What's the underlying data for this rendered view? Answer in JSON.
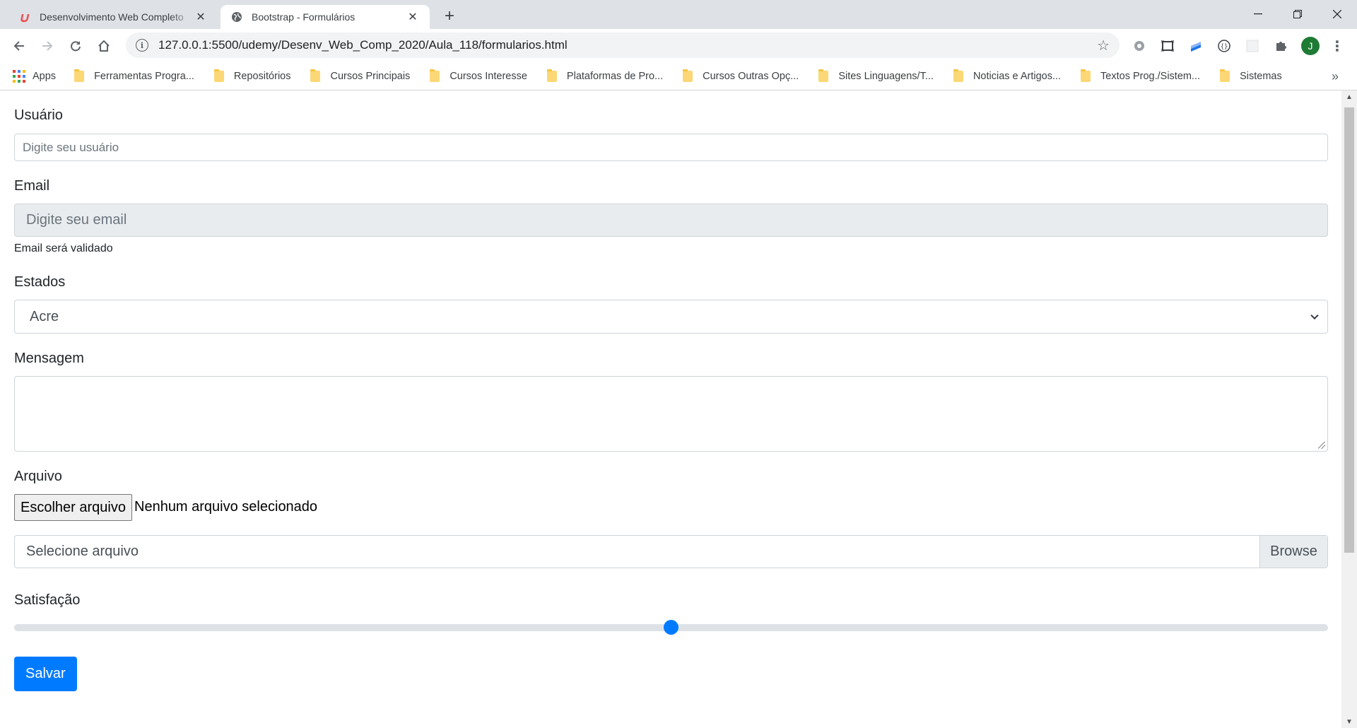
{
  "browser": {
    "tabs": [
      {
        "title": "Desenvolvimento Web Completo",
        "favicon": "udemy-icon",
        "active": false
      },
      {
        "title": "Bootstrap - Formulários",
        "favicon": "globe-icon",
        "active": true
      }
    ],
    "new_tab_label": "+",
    "window_controls": {
      "minimize": "—",
      "restore": "❐",
      "close": "✕"
    },
    "url": "127.0.0.1:5500/udemy/Desenv_Web_Comp_2020/Aula_118/formularios.html",
    "bookmarks": [
      {
        "label": "Apps",
        "icon": "apps-grid-icon"
      },
      {
        "label": "Ferramentas Progra...",
        "icon": "folder-icon"
      },
      {
        "label": "Repositórios",
        "icon": "folder-icon"
      },
      {
        "label": "Cursos Principais",
        "icon": "folder-icon"
      },
      {
        "label": "Cursos Interesse",
        "icon": "folder-icon"
      },
      {
        "label": "Plataformas de Pro...",
        "icon": "folder-icon"
      },
      {
        "label": "Cursos Outras Opç...",
        "icon": "folder-icon"
      },
      {
        "label": "Sites Linguagens/T...",
        "icon": "folder-icon"
      },
      {
        "label": "Noticias e Artigos...",
        "icon": "folder-icon"
      },
      {
        "label": "Textos Prog./Sistem...",
        "icon": "folder-icon"
      },
      {
        "label": "Sistemas",
        "icon": "folder-icon"
      }
    ],
    "bookmarks_more": "»",
    "profile_initial": "J",
    "colors": {
      "tabbar": "#dee1e6",
      "omnibox": "#f1f3f4",
      "profile": "#1e7b34",
      "folder": "#fbd775"
    }
  },
  "form": {
    "usuario": {
      "label": "Usuário",
      "placeholder": "Digite seu usuário",
      "value": ""
    },
    "email": {
      "label": "Email",
      "placeholder": "Digite seu email",
      "help": "Email será validado"
    },
    "estados": {
      "label": "Estados",
      "selected": "Acre"
    },
    "mensagem": {
      "label": "Mensagem",
      "value": ""
    },
    "arquivo": {
      "label": "Arquivo",
      "button": "Escolher arquivo",
      "status": "Nenhum arquivo selecionado",
      "custom_placeholder": "Selecione arquivo",
      "browse": "Browse"
    },
    "satisfacao": {
      "label": "Satisfação",
      "value_fraction": 0.5
    },
    "submit": "Salvar",
    "colors": {
      "primary": "#007bff",
      "readonly_bg": "#e9ecef",
      "border": "#ced4da"
    }
  }
}
